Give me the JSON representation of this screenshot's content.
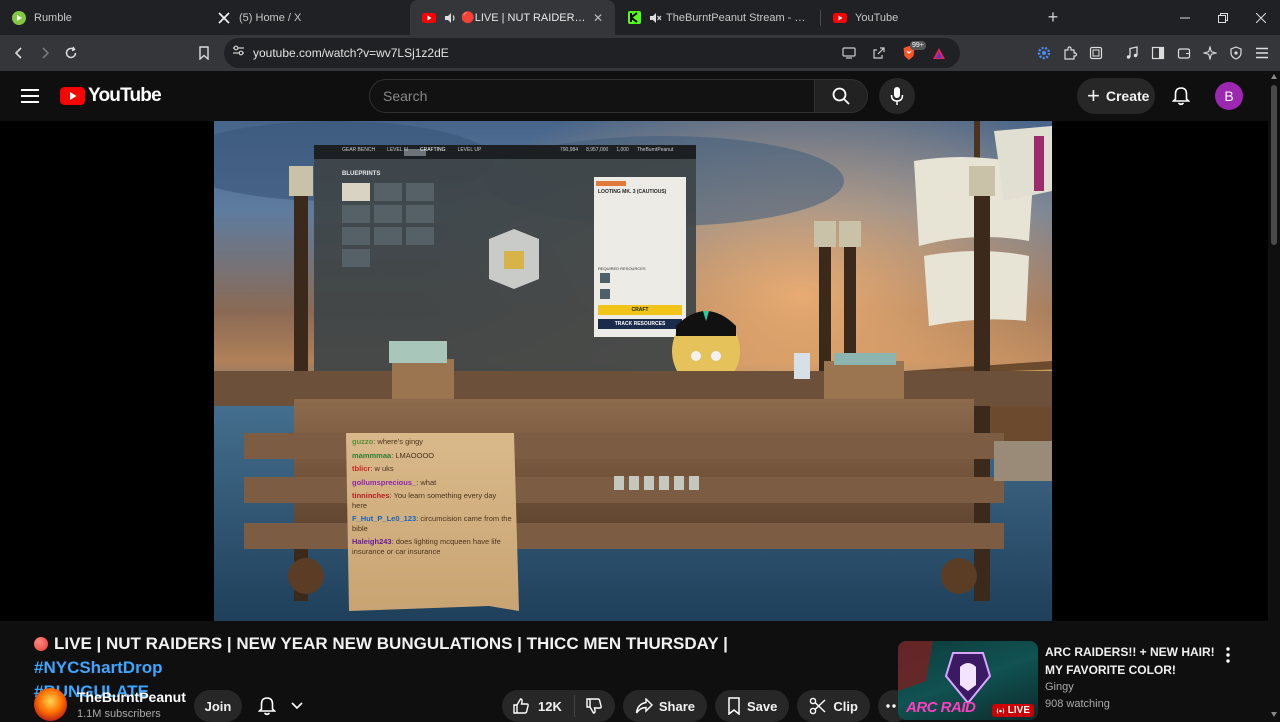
{
  "browser": {
    "tabs": [
      {
        "title": "Rumble",
        "icon": "rumble-icon",
        "active": false
      },
      {
        "title": "(5) Home / X",
        "icon": "x-icon",
        "active": false
      },
      {
        "title": "🔴LIVE | NUT RAIDERS | NEW",
        "icon": "youtube-icon",
        "active": true
      },
      {
        "title": "TheBurntPeanut Stream - Watch",
        "icon": "kick-icon",
        "active": false
      },
      {
        "title": "YouTube",
        "icon": "youtube-icon",
        "active": false
      }
    ],
    "url": "youtube.com/watch?v=wv7LSj1z2dE",
    "brave_badge": "99+"
  },
  "header": {
    "logo_text": "YouTube",
    "search_placeholder": "Search",
    "create_label": "Create",
    "avatar_letter": "B",
    "avatar_color": "#9c27b0"
  },
  "stream_overlay": {
    "game_header": [
      "GEAR BENCH",
      "LEVEL III",
      "CRAFTING",
      "LEVEL UP"
    ],
    "blueprints_label": "BLUEPRINTS",
    "item_name": "LOOTING MK. 3 (CAUTIOUS)",
    "required_label": "REQUIRED RESOURCES",
    "craft_label": "CRAFT",
    "track_label": "TRACK RESOURCES",
    "stats": [
      "790,984",
      "8,957,000",
      "1,000"
    ],
    "streamer_tag": "TheBurntPeanut"
  },
  "chat": [
    {
      "user": "guzzo",
      "msg": "where's gingy",
      "color": "#5e8c3a"
    },
    {
      "user": "mammmaa",
      "msg": "LMAOOOO",
      "color": "#2e7d32"
    },
    {
      "user": "tblicr",
      "msg": "w uks",
      "color": "#c62828"
    },
    {
      "user": "gollumsprecious_",
      "msg": "what",
      "color": "#8e24aa"
    },
    {
      "user": "tinninches",
      "msg": "You learn something every day here",
      "color": "#b71c1c"
    },
    {
      "user": "F_Hut_P_Le0_123",
      "msg": "circumcision came from the bible",
      "color": "#1565c0"
    },
    {
      "user": "Haleigh243",
      "msg": "does lighting mcqueen have life insurance or car insurance",
      "color": "#6a1b9a"
    }
  ],
  "video": {
    "title_main": "LIVE | NUT RAIDERS | NEW YEAR NEW BUNGULATIONS | THICC MEN THURSDAY | ",
    "hashtag1": "#NYCShartDrop",
    "hashtag2": "#BUNGULATE",
    "channel": "TheBurntPeanut",
    "subscribers": "1.1M subscribers",
    "join_label": "Join",
    "likes": "12K",
    "share_label": "Share",
    "save_label": "Save",
    "clip_label": "Clip"
  },
  "recommendation": {
    "title": "ARC RAIDERS!! + NEW HAIR! MY FAVORITE COLOR!",
    "channel": "Gingy",
    "viewers": "908 watching",
    "badge": "LIVE",
    "thumb_text": "ARC RAID"
  }
}
